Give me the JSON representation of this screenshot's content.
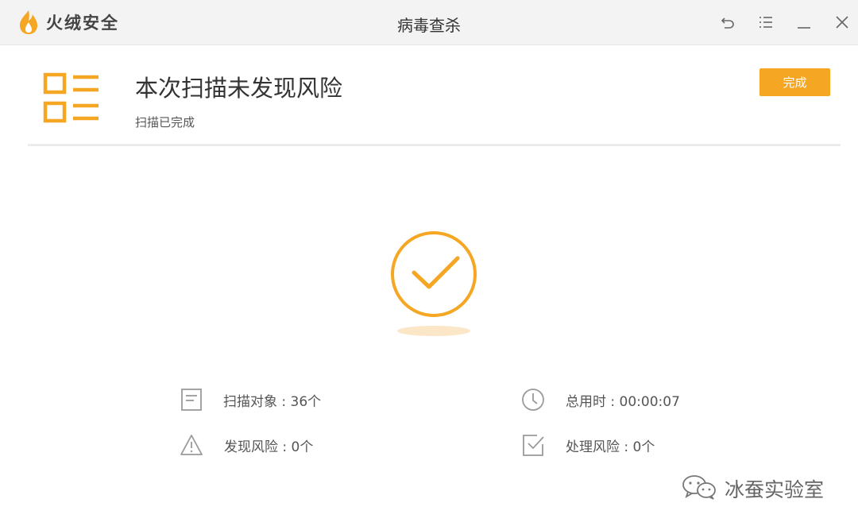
{
  "app": {
    "brand_name": "火绒安全",
    "window_title": "病毒查杀"
  },
  "window_controls": [
    "back",
    "menu",
    "minimize",
    "close"
  ],
  "result": {
    "title": "本次扫描未发现风险",
    "subtitle": "扫描已完成",
    "done_label": "完成"
  },
  "stats": {
    "scanned_objects": "扫描对象 : 36个",
    "total_time": "总用时 : 00:00:07",
    "risks_found": "发现风险 : 0个",
    "risks_handled": "处理风险 : 0个"
  },
  "watermark": {
    "text": "冰蚕实验室"
  },
  "colors": {
    "accent": "#f5a623",
    "icon_gray": "#9a9a9a",
    "titlebar_bg": "#f3f3f3"
  }
}
